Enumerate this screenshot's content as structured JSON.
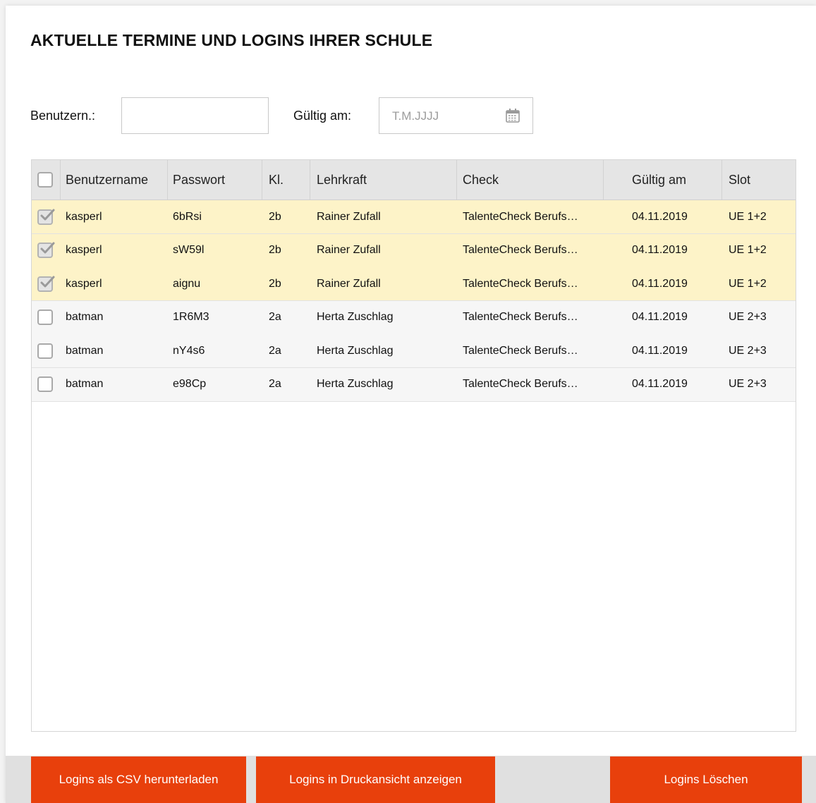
{
  "title": "AKTUELLE TERMINE UND LOGINS IHRER SCHULE",
  "filters": {
    "username_label": "Benutzern.:",
    "username_value": "",
    "date_label": "Gültig am:",
    "date_placeholder": "T.M.JJJJ"
  },
  "table": {
    "columns": [
      "Benutzername",
      "Passwort",
      "Kl.",
      "Lehrkraft",
      "Check",
      "Gültig am",
      "Slot"
    ],
    "rows": [
      {
        "checked": true,
        "user": "kasperl",
        "pass": "6bRsi",
        "kl": "2b",
        "lehrkraft": "Rainer Zufall",
        "check": "TalenteCheck Berufs…",
        "date": "04.11.2019",
        "slot": "UE 1+2"
      },
      {
        "checked": true,
        "user": "kasperl",
        "pass": "sW59l",
        "kl": "2b",
        "lehrkraft": "Rainer Zufall",
        "check": "TalenteCheck Berufs…",
        "date": "04.11.2019",
        "slot": "UE 1+2"
      },
      {
        "checked": true,
        "user": "kasperl",
        "pass": "aignu",
        "kl": "2b",
        "lehrkraft": "Rainer Zufall",
        "check": "TalenteCheck Berufs…",
        "date": "04.11.2019",
        "slot": "UE 1+2"
      },
      {
        "checked": false,
        "user": "batman",
        "pass": "1R6M3",
        "kl": "2a",
        "lehrkraft": "Herta Zuschlag",
        "check": "TalenteCheck Berufs…",
        "date": "04.11.2019",
        "slot": "UE 2+3"
      },
      {
        "checked": false,
        "user": "batman",
        "pass": "nY4s6",
        "kl": "2a",
        "lehrkraft": "Herta Zuschlag",
        "check": "TalenteCheck Berufs…",
        "date": "04.11.2019",
        "slot": "UE 2+3"
      },
      {
        "checked": false,
        "user": "batman",
        "pass": "e98Cp",
        "kl": "2a",
        "lehrkraft": "Herta Zuschlag",
        "check": "TalenteCheck Berufs…",
        "date": "04.11.2019",
        "slot": "UE 2+3"
      }
    ]
  },
  "buttons": {
    "csv": "Logins als CSV herunterladen",
    "print": "Logins in Druckansicht anzeigen",
    "delete": "Logins Löschen"
  },
  "colors": {
    "accent": "#e8400c",
    "selected_row": "#fdf3c8"
  }
}
